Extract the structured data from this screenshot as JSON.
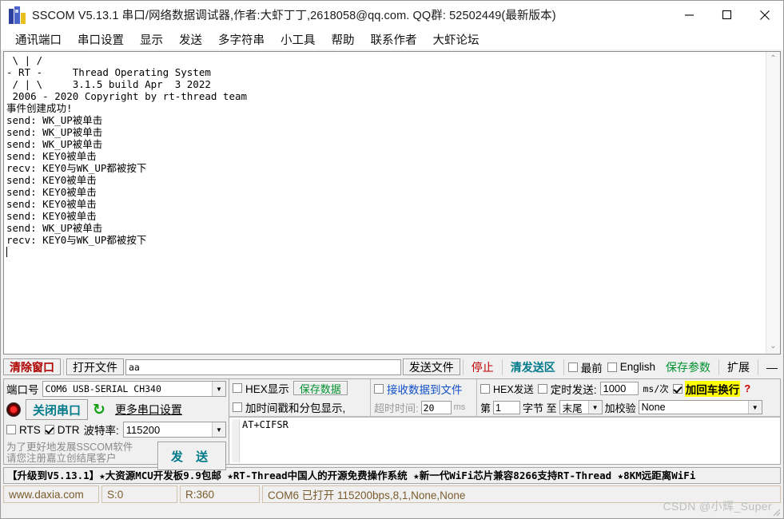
{
  "window": {
    "title": "SSCOM V5.13.1 串口/网络数据调试器,作者:大虾丁丁,2618058@qq.com. QQ群: 52502449(最新版本)",
    "minimize": "—",
    "maximize": "□",
    "close": "✕"
  },
  "menu": {
    "items": [
      {
        "label": "通讯端口"
      },
      {
        "label": "串口设置"
      },
      {
        "label": "显示"
      },
      {
        "label": "发送"
      },
      {
        "label": "多字符串"
      },
      {
        "label": "小工具"
      },
      {
        "label": "帮助"
      },
      {
        "label": "联系作者"
      },
      {
        "label": "大虾论坛"
      }
    ]
  },
  "terminal": {
    "lines": [
      " \\ | /",
      "- RT -     Thread Operating System",
      " / | \\     3.1.5 build Apr  3 2022",
      " 2006 - 2020 Copyright by rt-thread team",
      "事件创建成功!",
      "send: WK_UP被单击",
      "send: WK_UP被单击",
      "send: WK_UP被单击",
      "send: KEY0被单击",
      "recv: KEY0与WK_UP都被按下",
      "send: KEY0被单击",
      "send: KEY0被单击",
      "send: KEY0被单击",
      "send: KEY0被单击",
      "send: WK_UP被单击",
      "recv: KEY0与WK_UP都被按下"
    ],
    "scroll_up_icon": "⌃",
    "scroll_down_icon": "⌄"
  },
  "toolbar": {
    "clear_window": "清除窗口",
    "open_file": "打开文件",
    "file_path_value": "aa",
    "send_file": "发送文件",
    "stop": "停止",
    "clear_send": "清发送区",
    "topmost": "最前",
    "topmost_checked": false,
    "english": "English",
    "english_checked": false,
    "save_params": "保存参数",
    "expand": "扩展",
    "collapse": "—"
  },
  "port_panel": {
    "port_label": "端口号",
    "port_value": "COM6 USB-SERIAL CH340",
    "close_port_button": "关闭串口",
    "refresh_icon": "↻",
    "more_settings": "更多串口设置",
    "rts_label": "RTS",
    "rts_checked": false,
    "dtr_label": "DTR",
    "dtr_checked": true,
    "baud_label": "波特率:",
    "baud_value": "115200",
    "promo": "为了更好地发展SSCOM软件\n请您注册嘉立创结尾客户",
    "send_button": "发 送"
  },
  "recv_options": {
    "hex_display": "HEX显示",
    "hex_display_checked": false,
    "save_data": "保存数据",
    "timestamp": "加时间戳和分包显示,",
    "timestamp_checked": false,
    "recv_to_file": "接收数据到文件",
    "recv_to_file_checked": false,
    "timeout_label": "超时时间:",
    "timeout_value": "20",
    "timeout_unit": "ms"
  },
  "send_options": {
    "hex_send": "HEX发送",
    "hex_send_checked": false,
    "timed_send": "定时发送:",
    "timed_send_checked": false,
    "interval_value": "1000",
    "interval_unit": "ms/次",
    "crlf": "加回车换行",
    "crlf_checked": true,
    "help_mark": "?",
    "byte_from": "第",
    "byte_index": "1",
    "byte_to": "字节 至",
    "byte_end": "末尾",
    "checksum_label": "加校验",
    "checksum_value": "None"
  },
  "send_area": {
    "text": "AT+CIFSR"
  },
  "ad_bar": {
    "text": "【升级到V5.13.1】★大资源MCU开发板9.9包邮 ★RT-Thread中国人的开源免费操作系统 ★新一代WiFi芯片兼容8266支持RT-Thread ★8KM远距离WiFi"
  },
  "status_bar": {
    "site": "www.daxia.com",
    "sent": "S:0",
    "received": "R:360",
    "connection": "COM6 已打开  115200bps,8,1,None,None"
  },
  "watermark": {
    "text": "CSDN @小辉_Super"
  },
  "colors": {
    "accent_teal": "#007a8a",
    "red": "#c00000",
    "green": "#00912f",
    "blue": "#1250c8",
    "highlight": "#ffff00",
    "status_text": "#7a5c2e"
  }
}
